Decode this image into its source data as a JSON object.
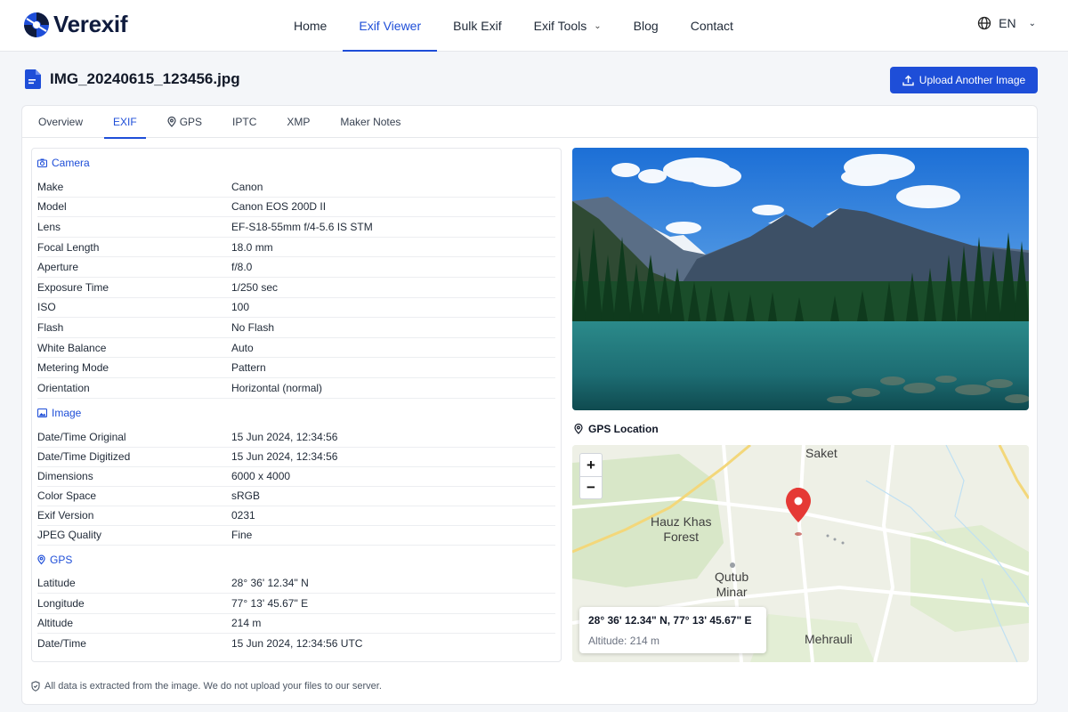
{
  "brand": {
    "name": "Verexif"
  },
  "nav": {
    "items": [
      {
        "label": "Home"
      },
      {
        "label": "Exif Viewer"
      },
      {
        "label": "Bulk Exif"
      },
      {
        "label": "Exif Tools"
      },
      {
        "label": "Blog"
      },
      {
        "label": "Contact"
      }
    ],
    "active": "Exif Viewer",
    "language": "EN"
  },
  "file": {
    "name": "IMG_20240615_123456.jpg"
  },
  "upload_button": "Upload Another Image",
  "tabs": [
    {
      "label": "Overview"
    },
    {
      "label": "EXIF"
    },
    {
      "label": "GPS"
    },
    {
      "label": "IPTC"
    },
    {
      "label": "XMP"
    },
    {
      "label": "Maker Notes"
    }
  ],
  "active_tab": "EXIF",
  "sections": {
    "camera": {
      "title": "Camera",
      "rows": [
        {
          "key": "Make",
          "value": "Canon"
        },
        {
          "key": "Model",
          "value": "Canon EOS 200D II"
        },
        {
          "key": "Lens",
          "value": "EF-S18-55mm f/4-5.6 IS STM"
        },
        {
          "key": "Focal Length",
          "value": "18.0 mm"
        },
        {
          "key": "Aperture",
          "value": "f/8.0"
        },
        {
          "key": "Exposure Time",
          "value": "1/250 sec"
        },
        {
          "key": "ISO",
          "value": "100"
        },
        {
          "key": "Flash",
          "value": "No Flash"
        },
        {
          "key": "White Balance",
          "value": "Auto"
        },
        {
          "key": "Metering Mode",
          "value": "Pattern"
        },
        {
          "key": "Orientation",
          "value": "Horizontal (normal)"
        }
      ]
    },
    "image": {
      "title": "Image",
      "rows": [
        {
          "key": "Date/Time Original",
          "value": "15 Jun 2024, 12:34:56"
        },
        {
          "key": "Date/Time Digitized",
          "value": "15 Jun 2024, 12:34:56"
        },
        {
          "key": "Dimensions",
          "value": "6000 x 4000"
        },
        {
          "key": "Color Space",
          "value": "sRGB"
        },
        {
          "key": "Exif Version",
          "value": "0231"
        },
        {
          "key": "JPEG Quality",
          "value": "Fine"
        }
      ]
    },
    "gps": {
      "title": "GPS",
      "rows": [
        {
          "key": "Latitude",
          "value": "28° 36' 12.34\" N"
        },
        {
          "key": "Longitude",
          "value": "77° 13' 45.67\" E"
        },
        {
          "key": "Altitude",
          "value": "214 m"
        },
        {
          "key": "Date/Time",
          "value": "15 Jun 2024, 12:34:56 UTC"
        }
      ]
    }
  },
  "gps_location": {
    "title": "GPS Location",
    "coords": "28° 36' 12.34\" N, 77° 13' 45.67\" E",
    "altitude": "Altitude: 214 m",
    "map_labels": [
      "Saket",
      "Hauz Khas\nForest",
      "Qutub\nMinar",
      "Mehrauli"
    ],
    "zoom_in": "+",
    "zoom_out": "−"
  },
  "footer_note": "All data is extracted from the image. We do not upload your files to our server.",
  "colors": {
    "accent": "#1e4ed8",
    "pin": "#e53935"
  },
  "icons": [
    "logo-icon",
    "globe-icon",
    "chevron-down-icon",
    "file-icon",
    "upload-icon",
    "map-pin-icon",
    "camera-icon",
    "image-icon",
    "shield-icon"
  ]
}
